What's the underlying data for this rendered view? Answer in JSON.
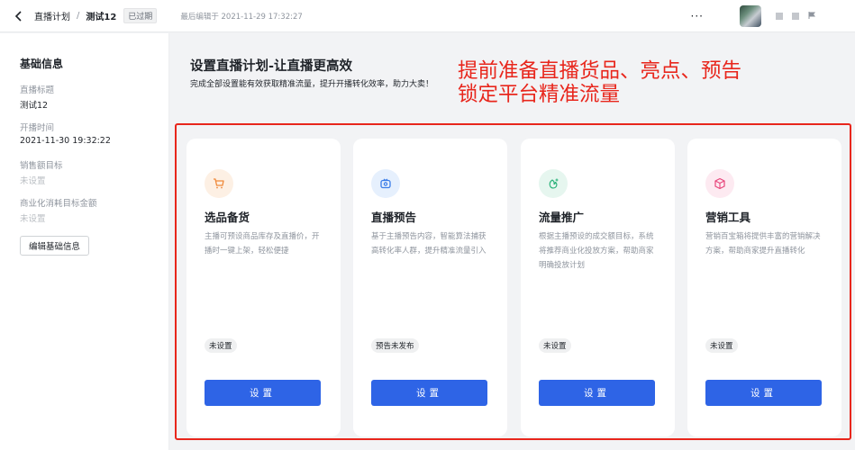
{
  "header": {
    "breadcrumb_root": "直播计划",
    "breadcrumb_sep": "/",
    "breadcrumb_current": "测试12",
    "status_badge": "已过期",
    "last_edited": "最后编辑于 2021-11-29 17:32:27",
    "more": "···"
  },
  "sidebar": {
    "title": "基础信息",
    "fields": [
      {
        "label": "直播标题",
        "value": "测试12"
      },
      {
        "label": "开播时间",
        "value": "2021-11-30 19:32:22"
      },
      {
        "label": "销售额目标",
        "value": "未设置"
      },
      {
        "label": "商业化消耗目标金额",
        "value": "未设置"
      }
    ],
    "edit_button": "编辑基础信息"
  },
  "main": {
    "title": "设置直播计划-让直播更高效",
    "subtitle": "完成全部设置能有效获取精准流量，提升开播转化效率，助力大卖！"
  },
  "annotation": {
    "line1": "提前准备直播货品、亮点、预告",
    "line2": "锁定平台精准流量",
    "color": "#e8261c"
  },
  "cards": [
    {
      "icon": "shopping-cart-icon",
      "title": "选品备货",
      "desc": "主播可预设商品库存及直播价，开播时一键上架，轻松便捷",
      "status": "未设置",
      "button": "设置",
      "icon_bg": "#fdf0e4",
      "icon_color": "#f0893a"
    },
    {
      "icon": "video-camera-icon",
      "title": "直播预告",
      "desc": "基于主播预告内容，智能算法捕获高转化率人群，提升精准流量引入",
      "status": "预告未发布",
      "button": "设置",
      "icon_bg": "#e6f0fd",
      "icon_color": "#3b7de8"
    },
    {
      "icon": "traffic-boost-icon",
      "title": "流量推广",
      "desc": "根据主播预设的成交额目标，系统将推荐商业化投放方案，帮助商家明确投放计划",
      "status": "未设置",
      "button": "设置",
      "icon_bg": "#e6f6ef",
      "icon_color": "#2bb27a"
    },
    {
      "icon": "gift-box-icon",
      "title": "营销工具",
      "desc": "营销百宝箱将提供丰富的营销解决方案，帮助商家提升直播转化",
      "status": "未设置",
      "button": "设置",
      "icon_bg": "#fdeaf1",
      "icon_color": "#e8467c"
    }
  ],
  "colors": {
    "primary_button": "#2e64e6",
    "annotation_red": "#e8261c"
  }
}
